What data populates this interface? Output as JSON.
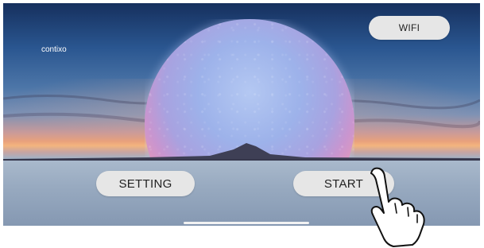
{
  "brand": {
    "label": "contixo"
  },
  "buttons": {
    "wifi_label": "WIFI",
    "setting_label": "SETTING",
    "start_label": "START"
  },
  "icons": {
    "pointer": "hand-pointer-icon",
    "home_indicator": "home-indicator"
  },
  "colors": {
    "button_bg": "#e6e6e6",
    "button_text": "#222222",
    "sky_top": "#16305e",
    "sunset": "#f3b47e",
    "planet_top": "#b4c8f2",
    "planet_bottom": "#f6b89c"
  }
}
